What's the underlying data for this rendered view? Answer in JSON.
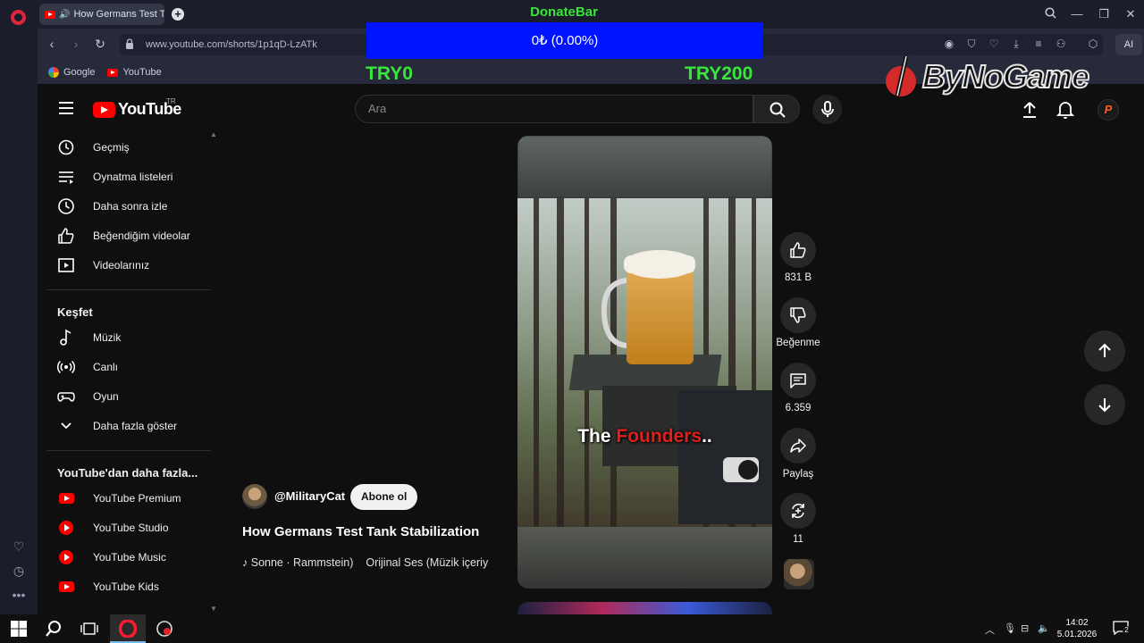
{
  "browser": {
    "tab_title": "How Germans Test Tar",
    "url": "www.youtube.com/shorts/1p1qD-LzATk",
    "ai_label": "AI",
    "bookmarks": [
      {
        "label": "Google",
        "icon": "google-icon"
      },
      {
        "label": "YouTube",
        "icon": "youtube-icon"
      }
    ]
  },
  "donate": {
    "title": "DonateBar",
    "progress_text": "0₺ (0.00%)",
    "progress_fraction": 0.0,
    "min_label": "TRY0",
    "max_label": "TRY200",
    "bar_color": "#0014ff",
    "text_color": "#39e639"
  },
  "watermark": {
    "text": "ByNoGame"
  },
  "youtube": {
    "logo_text": "YouTube",
    "region": "TR",
    "search_placeholder": "Ara",
    "avatar_letter": "P",
    "nav": {
      "you_items": [
        {
          "label": "Geçmiş",
          "icon": "history-icon"
        },
        {
          "label": "Oynatma listeleri",
          "icon": "playlist-icon"
        },
        {
          "label": "Daha sonra izle",
          "icon": "clock-icon"
        },
        {
          "label": "Beğendiğim videolar",
          "icon": "thumbs-up-icon"
        },
        {
          "label": "Videolarınız",
          "icon": "play-square-icon"
        }
      ],
      "explore_title": "Keşfet",
      "explore_items": [
        {
          "label": "Müzik",
          "icon": "music-note-icon"
        },
        {
          "label": "Canlı",
          "icon": "live-icon"
        },
        {
          "label": "Oyun",
          "icon": "gamepad-icon"
        },
        {
          "label": "Daha fazla göster",
          "icon": "chevron-down-icon"
        }
      ],
      "more_title": "YouTube'dan daha fazla...",
      "more_items": [
        {
          "label": "YouTube Premium",
          "icon": "youtube-premium-icon"
        },
        {
          "label": "YouTube Studio",
          "icon": "youtube-studio-icon"
        },
        {
          "label": "YouTube Music",
          "icon": "youtube-music-icon"
        },
        {
          "label": "YouTube Kids",
          "icon": "youtube-kids-icon"
        }
      ]
    },
    "short": {
      "caption_white": "The ",
      "caption_red": "Founders",
      "caption_tail": "..",
      "channel": "@MilitaryCat",
      "subscribe_label": "Abone ol",
      "title": "How Germans Test Tank Stabilization",
      "music_track": "Sonne · Rammstein)",
      "music_original": "Orijinal Ses (Müzik içeriy",
      "actions": {
        "likes": "831 B",
        "dislike_label": "Beğenme",
        "comments": "6.359",
        "share_label": "Paylaş",
        "remix_count": "11"
      }
    }
  },
  "taskbar": {
    "time": "14:02",
    "date": "5.01.2026",
    "notification_count": "2"
  }
}
